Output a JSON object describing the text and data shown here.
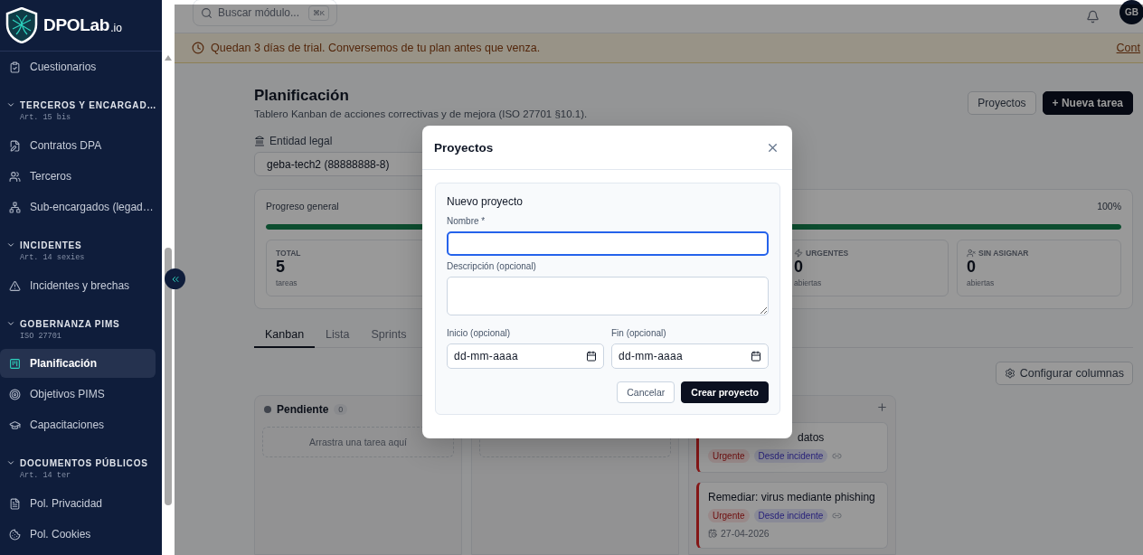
{
  "sidebar": {
    "brand": {
      "name": "DPOLab",
      "suffix": ".io"
    },
    "groups": [
      {
        "items": [
          {
            "label": "Cuestionarios",
            "selected": false
          }
        ]
      },
      {
        "title": "TERCEROS Y ENCARGAD…",
        "subtitle": "Art. 15 bis",
        "expanded": true,
        "items": [
          {
            "label": "Contratos DPA",
            "selected": false
          },
          {
            "label": "Terceros",
            "selected": false
          },
          {
            "label": "Sub-encargados (legad…",
            "selected": false
          }
        ]
      },
      {
        "title": "INCIDENTES",
        "subtitle": "Art. 14 sexies",
        "expanded": true,
        "items": [
          {
            "label": "Incidentes y brechas",
            "selected": false
          }
        ]
      },
      {
        "title": "GOBERNANZA PIMS",
        "subtitle": "ISO 27701",
        "expanded": true,
        "items": [
          {
            "label": "Planificación",
            "selected": true
          },
          {
            "label": "Objetivos PIMS",
            "selected": false
          },
          {
            "label": "Capacitaciones",
            "selected": false
          }
        ]
      },
      {
        "title": "DOCUMENTOS PÚBLICOS",
        "subtitle": "Art. 14 ter",
        "expanded": true,
        "items": [
          {
            "label": "Pol. Privacidad",
            "selected": false
          },
          {
            "label": "Pol. Cookies",
            "selected": false
          }
        ]
      }
    ]
  },
  "header": {
    "search": {
      "placeholder": "Buscar módulo...",
      "shortcut": "⌘K"
    },
    "avatar": "GB"
  },
  "banner": {
    "text": "Quedan 3 días de trial. Conversemos de tu plan antes que venza.",
    "link": "Cont"
  },
  "page": {
    "title": "Planificación",
    "subtitle": "Tablero Kanban de acciones correctivas y de mejora (ISO 27701 §10.1).",
    "actions": [
      {
        "label": "Proyectos",
        "kind": "outline"
      },
      {
        "label": "+ Nueva tarea",
        "kind": "primary"
      }
    ]
  },
  "entity": {
    "label": "Entidad legal",
    "value": "geba-tech2 (88888888-8)"
  },
  "progress": {
    "label": "Progreso general",
    "reading": "100%",
    "level": 1,
    "stats": [
      {
        "label": "TOTAL",
        "value": "5",
        "unit": "tareas",
        "kind": "stat"
      },
      {
        "kind": "hidden"
      },
      {
        "kind": "hidden"
      },
      {
        "label": "URGENTES",
        "value": "0",
        "unit": "abiertas",
        "kind": "stat"
      },
      {
        "label": "SIN ASIGNAR",
        "value": "0",
        "unit": "abiertas",
        "kind": "stat"
      }
    ]
  },
  "tabs": [
    {
      "label": "Kanban",
      "selected": true
    },
    {
      "label": "Lista",
      "selected": false
    },
    {
      "label": "Sprints",
      "selected": false
    }
  ],
  "configure_button": "Configurar columnas",
  "columns": [
    {
      "kind": "empty",
      "title": "Pendiente",
      "count": "0",
      "dropzone_text": "Arrastra una tarea aquí"
    },
    {
      "kind": "covered"
    },
    {
      "kind": "tasks",
      "cards": [
        {
          "title": "datos",
          "title_covered": true,
          "tags": [
            {
              "label": "Urgente",
              "kind": "urgent"
            },
            {
              "label": "Desde incidente",
              "kind": "source"
            }
          ],
          "linked": true
        },
        {
          "title": "Remediar: virus mediante phishing",
          "title_covered": false,
          "tags": [
            {
              "label": "Urgente",
              "kind": "urgent"
            },
            {
              "label": "Desde incidente",
              "kind": "source"
            }
          ],
          "linked": true,
          "date": "27-04-2026"
        }
      ]
    }
  ],
  "dialog": {
    "title": "Proyectos",
    "form": {
      "title": "Nuevo proyecto",
      "fields": [
        {
          "kind": "text",
          "label": "Nombre *",
          "focused": true
        },
        {
          "kind": "textarea",
          "label": "Descripción (opcional)",
          "focused": false
        }
      ],
      "dates": [
        {
          "label": "Inicio (opcional)",
          "placeholder": "dd-mm-aaaa"
        },
        {
          "label": "Fin (opcional)",
          "placeholder": "dd-mm-aaaa"
        }
      ],
      "buttons": [
        {
          "label": "Cancelar",
          "kind": "secondary"
        },
        {
          "label": "Crear proyecto",
          "kind": "primary"
        }
      ]
    }
  }
}
